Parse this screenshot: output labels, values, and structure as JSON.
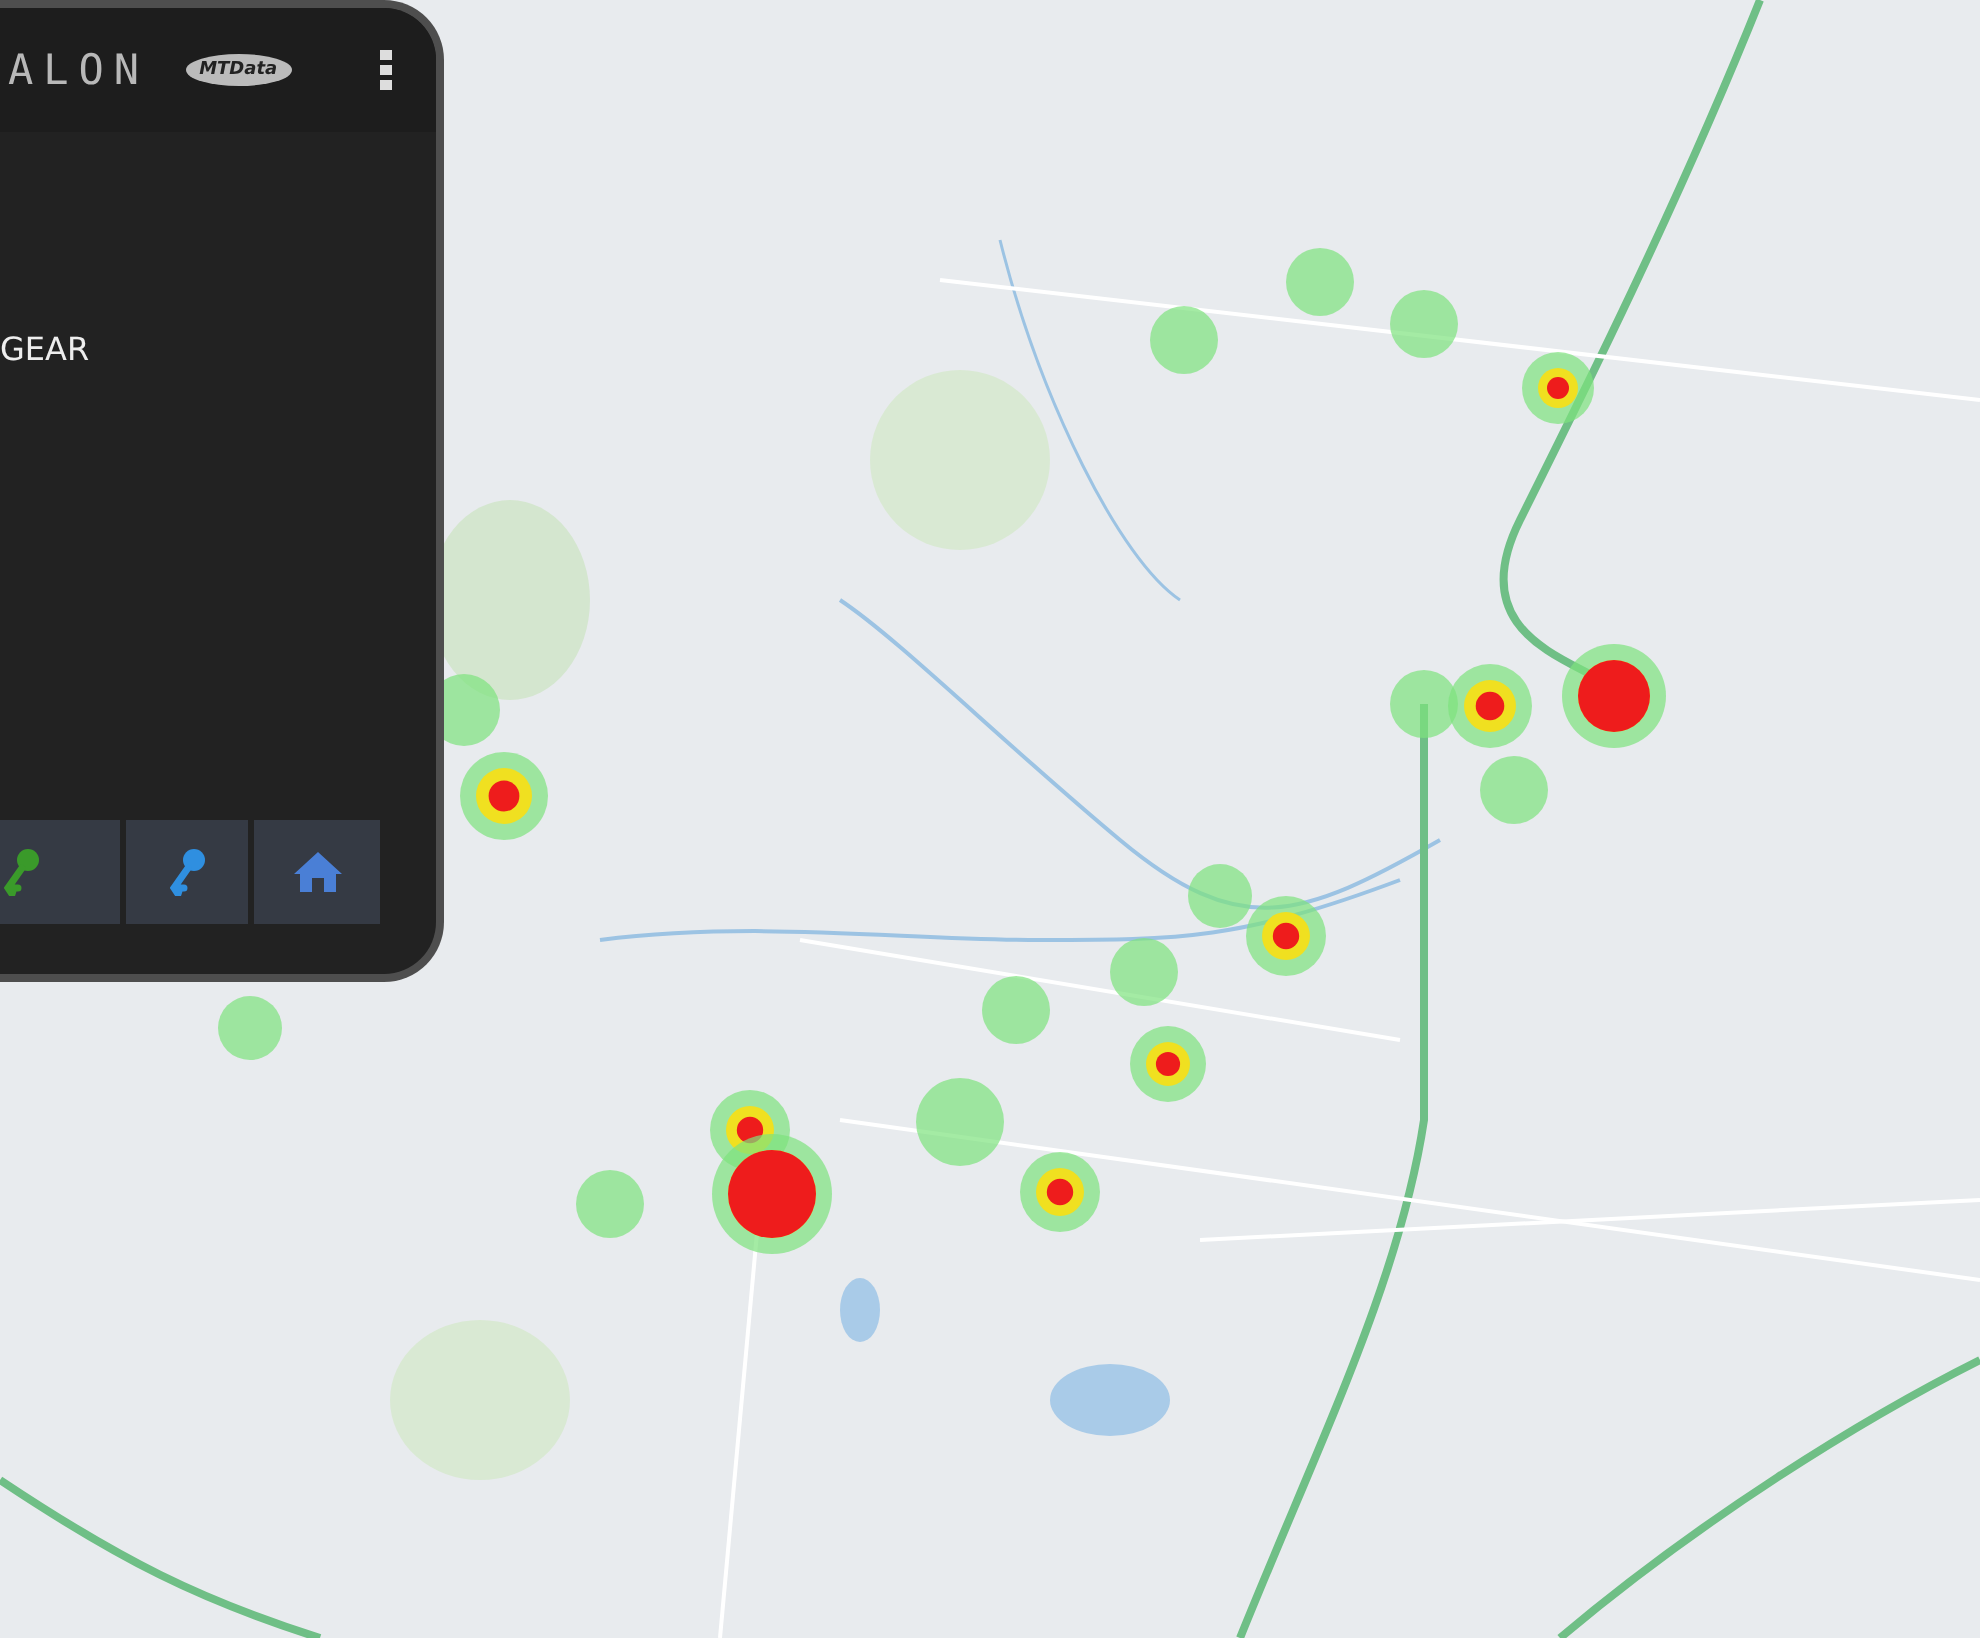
{
  "device_panel": {
    "app_title": "ALON",
    "logo_text": "MTData",
    "status_text": "GEAR",
    "buttons": [
      {
        "kind": "key",
        "color": "#3a9a2a"
      },
      {
        "kind": "key",
        "color": "#2f8fe0"
      },
      {
        "kind": "home",
        "color": "#4a7fd6"
      }
    ]
  }
}
